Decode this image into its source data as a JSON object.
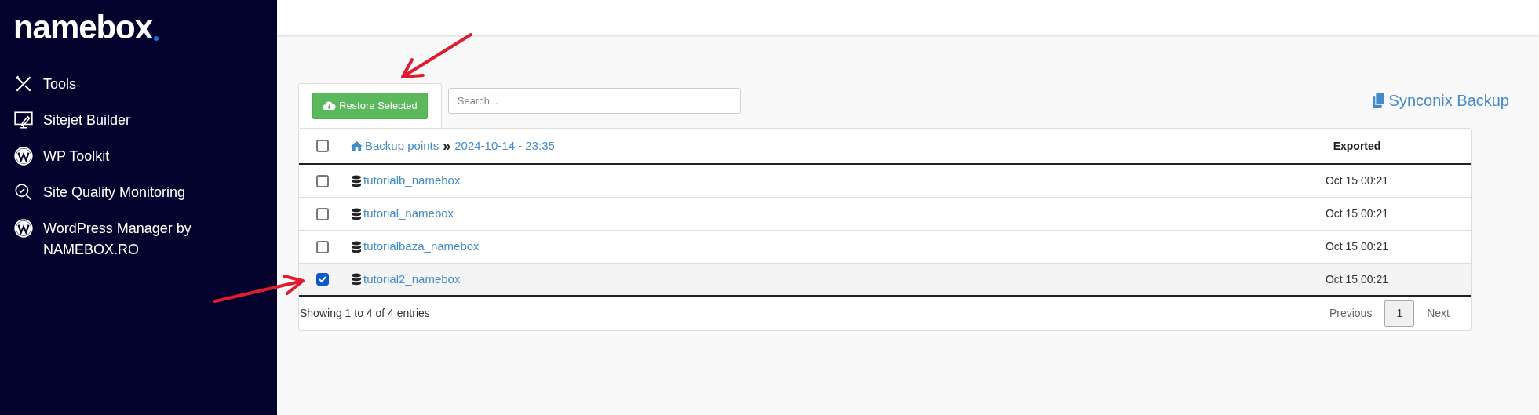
{
  "sidebar": {
    "logo": "namebox",
    "items": [
      {
        "kind": "tools",
        "label": "Tools"
      },
      {
        "kind": "builder",
        "label": "Sitejet Builder"
      },
      {
        "kind": "wordpress",
        "label": "WP Toolkit"
      },
      {
        "kind": "monitor",
        "label": "Site Quality Monitoring"
      },
      {
        "kind": "wordpress",
        "label": "WordPress Manager by NAMEBOX.RO"
      }
    ]
  },
  "toolbar": {
    "restore_button": "Restore Selected",
    "search": {
      "placeholder": "Search..."
    },
    "brand": "Synconix Backup"
  },
  "table": {
    "header": {
      "checked": false,
      "breadcrumb_root": "Backup points",
      "breadcrumb_separator": "»",
      "breadcrumb_current": "2024-10-14 - 23:35",
      "exported_column": "Exported"
    },
    "rows": [
      {
        "name": "tutorialb_namebox",
        "exported": "Oct 15 00:21",
        "checked": false
      },
      {
        "name": "tutorial_namebox",
        "exported": "Oct 15 00:21",
        "checked": false
      },
      {
        "name": "tutorialbaza_namebox",
        "exported": "Oct 15 00:21",
        "checked": false
      },
      {
        "name": "tutorial2_namebox",
        "exported": "Oct 15 00:21",
        "checked": true
      }
    ],
    "info": "Showing 1 to 4 of 4 entries",
    "pagination": [
      {
        "label": "Previous",
        "selected": false
      },
      {
        "label": "1",
        "selected": true
      },
      {
        "label": "Next",
        "selected": false
      }
    ]
  }
}
